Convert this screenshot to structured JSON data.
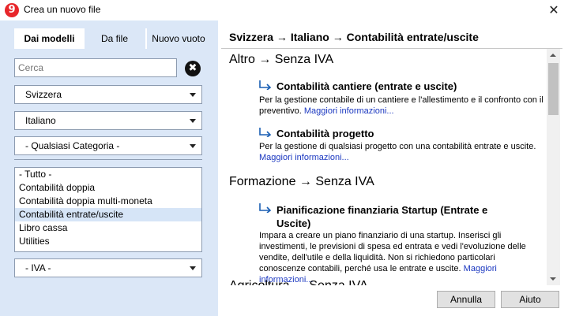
{
  "window": {
    "title": "Crea un nuovo file",
    "app_icon_glyph": "9",
    "close_glyph": "✕"
  },
  "tabs": [
    {
      "label": "Dai modelli"
    },
    {
      "label": "Da file"
    },
    {
      "label": "Nuovo vuoto"
    }
  ],
  "search": {
    "placeholder": "Cerca",
    "clear_glyph": "✖"
  },
  "filters": {
    "country": "Svizzera",
    "language": "Italiano",
    "category": "- Qualsiasi Categoria -",
    "vat": "- IVA -"
  },
  "categories": [
    "- Tutto -",
    "Contabilità doppia",
    "Contabilità doppia multi-moneta",
    "Contabilità entrate/uscite",
    "Libro cassa",
    "Utilities"
  ],
  "breadcrumb": "Svizzera → Italiano → Contabilità entrate/uscite",
  "sections": [
    {
      "heading": "Altro → Senza IVA",
      "templates": [
        {
          "title": "Contabilità cantiere (entrate e uscite)",
          "description": "Per la gestione contabile di un cantiere e l'allestimento e il confronto con il preventivo.",
          "more": "Maggiori informazioni..."
        },
        {
          "title": "Contabilità progetto",
          "description": "Per la gestione di qualsiasi progetto con una contabilità entrate e uscite.",
          "more": "Maggiori informazioni..."
        }
      ]
    },
    {
      "heading": "Formazione → Senza IVA",
      "templates": [
        {
          "title": "Pianificazione finanziaria Startup (Entrate e Uscite)",
          "description": "Impara a creare un piano finanziario di una startup. Inserisci gli investimenti, le previsioni di spesa ed entrata e vedi l'evoluzione delle vendite, dell'utile e della liquidità. Non si richiedono particolari conoscenze contabili, perché usa le entrate e uscite.",
          "more": "Maggiori informazioni..."
        }
      ]
    },
    {
      "heading": "Agricoltura → Senza IVA"
    }
  ],
  "buttons": {
    "cancel": "Annulla",
    "help": "Aiuto"
  },
  "colors": {
    "left_panel": "#dbe7f7",
    "link": "#1a37c0",
    "selected_row": "#d6e5f7",
    "app_icon": "#e8262a"
  }
}
